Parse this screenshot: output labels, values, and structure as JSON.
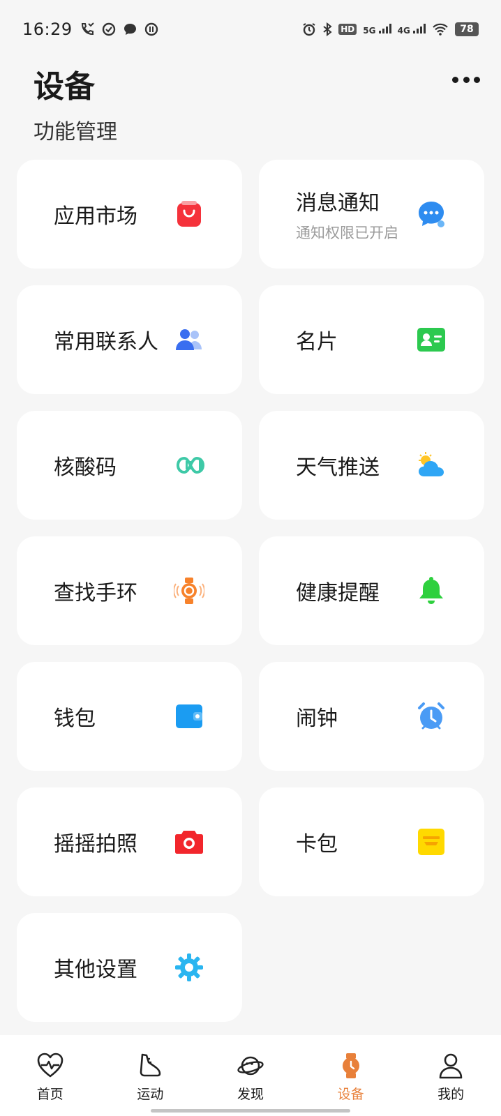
{
  "status_bar": {
    "time": "16:29",
    "left_icons": [
      "missed-call-icon",
      "assistant-icon",
      "message-icon",
      "app-notification-icon"
    ],
    "right_icons": [
      "alarm-icon",
      "bluetooth-icon",
      "hd-icon",
      "signal-5g-icon",
      "signal-4g-icon",
      "wifi-icon"
    ],
    "hd_label": "HD",
    "net1": "5G",
    "net2": "4G",
    "battery": "78"
  },
  "header": {
    "title": "设备",
    "more_icon": "more-dots-icon"
  },
  "section": {
    "title": "功能管理"
  },
  "cards": [
    {
      "id": "app-market",
      "label": "应用市场",
      "sub": "",
      "icon": "shopping-bag-icon",
      "color": "#f5323b"
    },
    {
      "id": "notifications",
      "label": "消息通知",
      "sub": "通知权限已开启",
      "icon": "chat-bubble-icon",
      "color": "#2e8cf0"
    },
    {
      "id": "contacts",
      "label": "常用联系人",
      "sub": "",
      "icon": "contacts-icon",
      "color": "#3a6ef0"
    },
    {
      "id": "business-card",
      "label": "名片",
      "sub": "",
      "icon": "id-card-icon",
      "color": "#2cc94f"
    },
    {
      "id": "nucleic-code",
      "label": "核酸码",
      "sub": "",
      "icon": "nucleic-code-icon",
      "color": "#3ec9a7"
    },
    {
      "id": "weather",
      "label": "天气推送",
      "sub": "",
      "icon": "weather-icon",
      "color": "#2fa6f5"
    },
    {
      "id": "find-band",
      "label": "查找手环",
      "sub": "",
      "icon": "find-band-icon",
      "color": "#f7822b"
    },
    {
      "id": "health-reminder",
      "label": "健康提醒",
      "sub": "",
      "icon": "bell-icon",
      "color": "#2ed03e"
    },
    {
      "id": "wallet",
      "label": "钱包",
      "sub": "",
      "icon": "wallet-icon",
      "color": "#1b9cf2"
    },
    {
      "id": "alarm",
      "label": "闹钟",
      "sub": "",
      "icon": "alarm-clock-icon",
      "color": "#4a9bf5"
    },
    {
      "id": "shake-photo",
      "label": "摇摇拍照",
      "sub": "",
      "icon": "camera-icon",
      "color": "#f2262c"
    },
    {
      "id": "card-wallet",
      "label": "卡包",
      "sub": "",
      "icon": "card-pack-icon",
      "color": "#ffd900"
    },
    {
      "id": "other-settings",
      "label": "其他设置",
      "sub": "",
      "icon": "gear-icon",
      "color": "#2ab5f0"
    }
  ],
  "bottom_nav": {
    "items": [
      {
        "label": "首页",
        "icon": "heart-pulse-icon"
      },
      {
        "label": "运动",
        "icon": "shoe-icon"
      },
      {
        "label": "发现",
        "icon": "planet-icon"
      },
      {
        "label": "设备",
        "icon": "watch-icon",
        "active": true
      },
      {
        "label": "我的",
        "icon": "person-icon"
      }
    ],
    "active_color": "#e8803a"
  }
}
